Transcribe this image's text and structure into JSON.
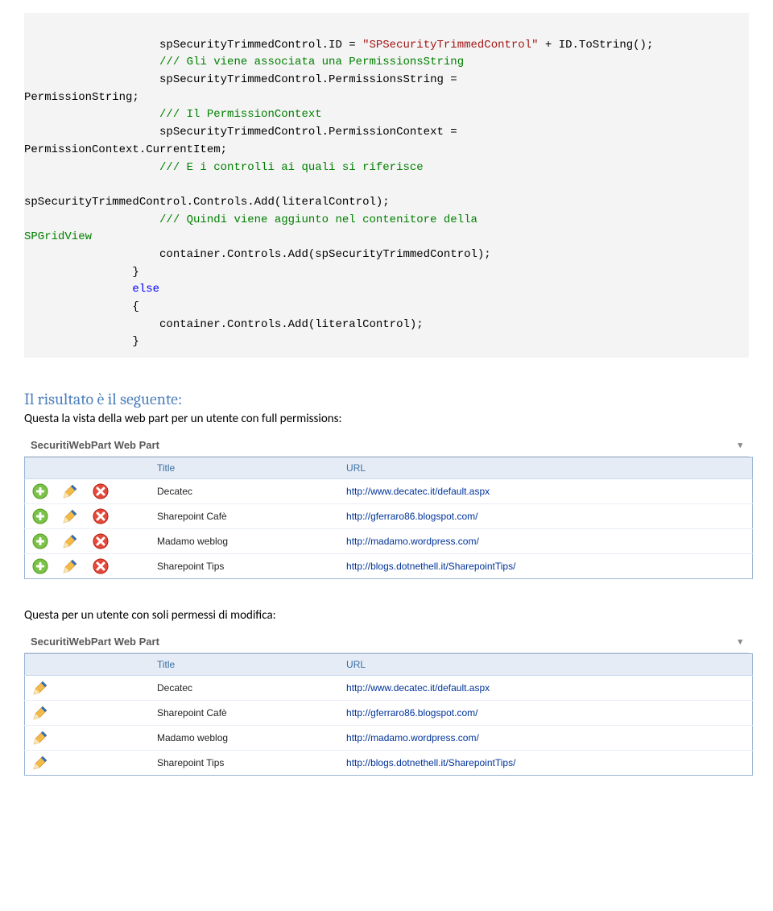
{
  "code": {
    "l01a": "                    spSecurityTrimmedControl.ID = ",
    "l01b": "\"SPSecurityTrimmedControl\"",
    "l01c": " + ID.ToString();",
    "l02": "                    /// Gli viene associata una PermissionsString",
    "l03": "                    spSecurityTrimmedControl.PermissionsString = ",
    "l03b": "PermissionString;",
    "l04": "                    /// Il PermissionContext",
    "l05": "                    spSecurityTrimmedControl.PermissionContext = ",
    "l05b": "PermissionContext.CurrentItem;",
    "l06": "                    /// E i controlli ai quali si riferisce",
    "l07": "",
    "l08": "spSecurityTrimmedControl.Controls.Add(literalControl);",
    "l09a": "                    /// Quindi viene aggiunto nel contenitore della ",
    "l09b": "SPGridView",
    "l10": "                    container.Controls.Add(spSecurityTrimmedControl);",
    "l11": "                }",
    "l12": "                else",
    "l13": "                {",
    "l14": "                    container.Controls.Add(literalControl);",
    "l15": "                }"
  },
  "heading": "Il risultato è il seguente:",
  "caption1": "Questa la vista della web part per un utente con full permissions:",
  "caption2": "Questa per un utente con soli permessi di modifica:",
  "webpart_title": "SecuritiWebPart Web Part",
  "columns": {
    "blank": "",
    "title": "Title",
    "url": "URL"
  },
  "rows": [
    {
      "title": "Decatec",
      "url": "http://www.decatec.it/default.aspx"
    },
    {
      "title": "Sharepoint Cafè",
      "url": "http://gferraro86.blogspot.com/"
    },
    {
      "title": "Madamo weblog",
      "url": "http://madamo.wordpress.com/"
    },
    {
      "title": "Sharepoint Tips",
      "url": "http://blogs.dotnethell.it/SharepointTips/"
    }
  ]
}
